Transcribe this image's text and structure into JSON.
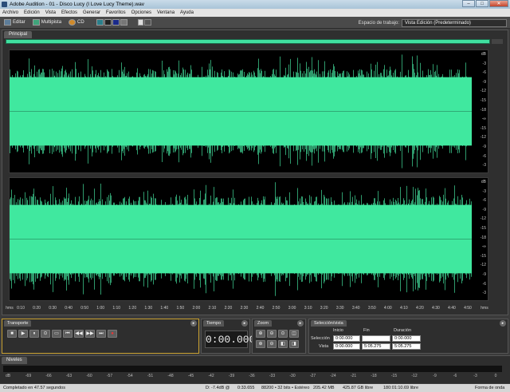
{
  "window": {
    "title": "Adobe Audition - 01 - Disco Lucy (I Love Lucy Theme).wav",
    "minimize": "–",
    "maximize": "□",
    "close": "✕"
  },
  "menu": [
    "Archivo",
    "Edición",
    "Vista",
    "Efectos",
    "Generar",
    "Favoritos",
    "Opciones",
    "Ventana",
    "Ayuda"
  ],
  "toolbar": {
    "edit": "Editar",
    "multitrack": "Multipista",
    "cd": "CD",
    "workspace_label": "Espacio de trabajo:",
    "workspace_value": "Vista Edición (Predeterminado)"
  },
  "main_panel": {
    "tab": "Principal",
    "wave_color": "#40e89f"
  },
  "db_scale": [
    "dB",
    "-3",
    "-6",
    "-9",
    "-12",
    "-15",
    "-18",
    "-∞",
    "-15",
    "-12",
    "-9",
    "-6",
    "-3"
  ],
  "time_ruler": [
    "hms",
    "0:10",
    "0:20",
    "0:30",
    "0:40",
    "0:50",
    "1:00",
    "1:10",
    "1:20",
    "1:30",
    "1:40",
    "1:50",
    "2:00",
    "2:10",
    "2:20",
    "2:30",
    "2:40",
    "2:50",
    "3:00",
    "3:10",
    "3:20",
    "3:30",
    "3:40",
    "3:50",
    "4:00",
    "4:10",
    "4:20",
    "4:30",
    "4:40",
    "4:50",
    "hms"
  ],
  "transport": {
    "tab": "Transporte",
    "buttons": [
      "■",
      "▶",
      "⏸",
      "⊙",
      "▭",
      "⏮",
      "◀◀",
      "▶▶",
      "⏭",
      "●"
    ]
  },
  "time": {
    "tab": "Tiempo",
    "value": "0:00.000"
  },
  "zoom": {
    "tab": "Zoom"
  },
  "selection": {
    "tab": "Selección/vista",
    "headers": [
      "Inicio",
      "Fin",
      "Duración"
    ],
    "rows": [
      {
        "label": "Selección",
        "start": "0:00.000",
        "end": "",
        "duration": "0:00.000"
      },
      {
        "label": "Vista",
        "start": "0:00.000",
        "end": "5:05.275",
        "duration": "5:05.275"
      }
    ]
  },
  "levels": {
    "tab": "Niveles",
    "scale": [
      "dB",
      "-69",
      "-66",
      "-63",
      "-60",
      "-57",
      "-54",
      "-51",
      "-48",
      "-45",
      "-42",
      "-39",
      "-36",
      "-33",
      "-30",
      "-27",
      "-24",
      "-21",
      "-18",
      "-15",
      "-12",
      "-9",
      "-6",
      "-3",
      "0"
    ]
  },
  "status": {
    "message": "Completado en 47.57 segundos",
    "peak": "D: -7.4dB @",
    "time": "0:33.655",
    "format": "88200 • 32 bits • Estéreo",
    "size": "205.42 MB",
    "disk": "425.87 GB libre",
    "free_time": "180:01:10.69 libre",
    "view": "Forma de onda"
  }
}
